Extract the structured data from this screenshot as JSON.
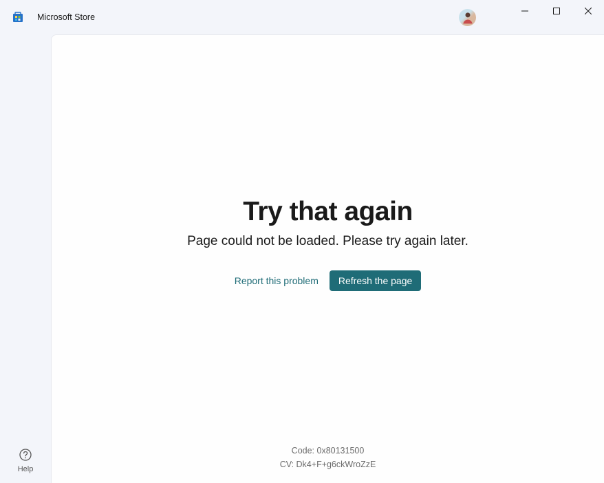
{
  "titlebar": {
    "app_title": "Microsoft Store"
  },
  "sidebar": {
    "help_label": "Help"
  },
  "error": {
    "title": "Try that again",
    "subtitle": "Page could not be loaded. Please try again later.",
    "report_label": "Report this problem",
    "refresh_label": "Refresh the page",
    "code_label": "Code: 0x80131500",
    "cv_label": "CV: Dk4+F+g6ckWroZzE"
  }
}
